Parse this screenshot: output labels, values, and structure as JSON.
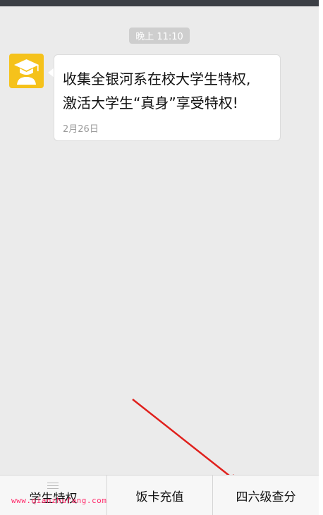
{
  "chat": {
    "timestamp": "晚上 11:10",
    "message": {
      "line1": "收集全银河系在校大学生特权,",
      "line2": "激活大学生“真身”享受特权!",
      "date": "2月26日"
    }
  },
  "menu": {
    "items": [
      {
        "label": "学生特权"
      },
      {
        "label": "饭卡充值"
      },
      {
        "label": "四六级查分"
      }
    ]
  },
  "watermark": {
    "text": "www.qianzhufang.com"
  },
  "colors": {
    "background": "#ebebeb",
    "avatar": "#f5c21b",
    "arrow": "#e0201c",
    "watermark": "#ff2a6a"
  }
}
